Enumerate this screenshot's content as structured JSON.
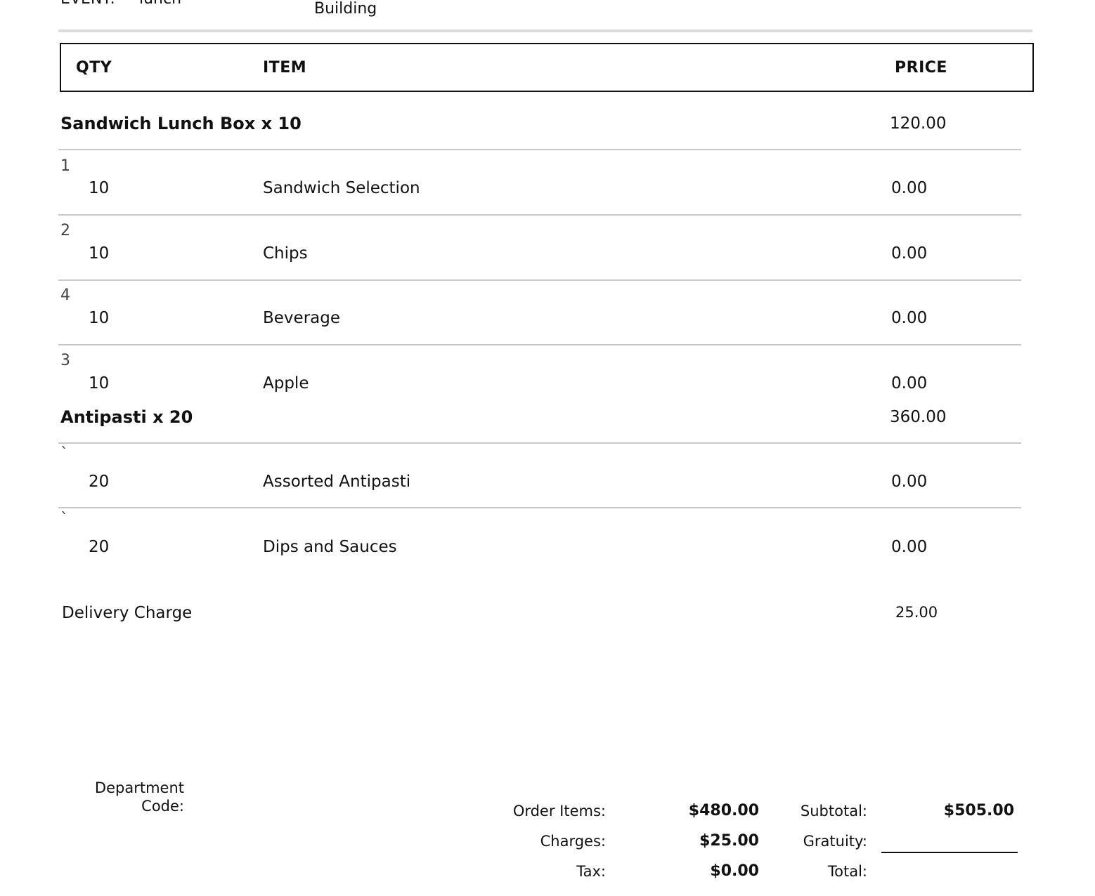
{
  "header": {
    "event_label": "EVENT:",
    "event_value": "lunch",
    "location_value": "Building"
  },
  "columns": {
    "qty": "QTY",
    "item": "ITEM",
    "price": "PRICE"
  },
  "packages": [
    {
      "name": "Sandwich Lunch Box x 10",
      "price": "120.00",
      "items": [
        {
          "seq": "1",
          "qty": "10",
          "item": "Sandwich Selection",
          "price": "0.00"
        },
        {
          "seq": "2",
          "qty": "10",
          "item": "Chips",
          "price": "0.00"
        },
        {
          "seq": "4",
          "qty": "10",
          "item": "Beverage",
          "price": "0.00"
        },
        {
          "seq": "3",
          "qty": "10",
          "item": "Apple",
          "price": "0.00"
        }
      ]
    },
    {
      "name": "Antipasti x 20",
      "price": "360.00",
      "items": [
        {
          "seq": "`",
          "qty": "20",
          "item": "Assorted Antipasti",
          "price": "0.00"
        },
        {
          "seq": "`",
          "qty": "20",
          "item": "Dips and Sauces",
          "price": "0.00"
        }
      ]
    }
  ],
  "delivery": {
    "label": "Delivery Charge",
    "price": "25.00"
  },
  "footer": {
    "department_code_label": "Department Code:",
    "order_items_label": "Order Items:",
    "order_items_value": "$480.00",
    "charges_label": "Charges:",
    "charges_value": "$25.00",
    "tax_label": "Tax:",
    "tax_value": "$0.00",
    "subtotal_label": "Subtotal:",
    "subtotal_value": "$505.00",
    "gratuity_label": "Gratuity:",
    "total_label": "Total:"
  }
}
